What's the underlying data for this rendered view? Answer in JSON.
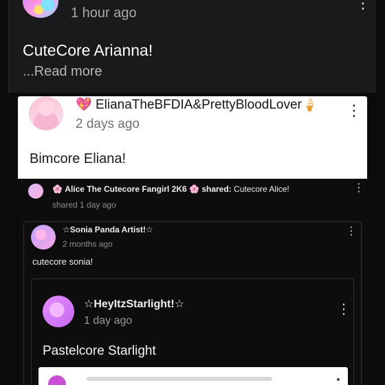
{
  "top_post": {
    "time": "1 hour ago",
    "title": "CuteCore Arianna!",
    "read_more": "...Read more",
    "menu_icon": "⋮"
  },
  "eliana_post": {
    "author_emoji": "💖",
    "author": "ElianaTheBFDIA&PrettyBloodLover",
    "author_suffix": "🍦",
    "time": "2 days ago",
    "text": "Bimcore Eliana!",
    "menu_icon": "⋮"
  },
  "shared_post": {
    "sharer_prefix": "🌸",
    "sharer": "Alice The Cutecore Fangirl 2K6",
    "sharer_suffix": "🌸",
    "shared_label": "shared:",
    "shared_title": "Cutecore Alice!",
    "time": "shared 1 day ago",
    "menu_icon": "⋮"
  },
  "sonia_post": {
    "author": "☆Sonia Panda Artist!☆",
    "time": "2 months ago",
    "text": "cutecore sonia!",
    "menu_icon": "⋮"
  },
  "starlight_post": {
    "author": "☆HeyItzStarlight!☆",
    "time": "1 day ago",
    "text": "Pastelcore Starlight",
    "menu_icon": "⋮"
  }
}
